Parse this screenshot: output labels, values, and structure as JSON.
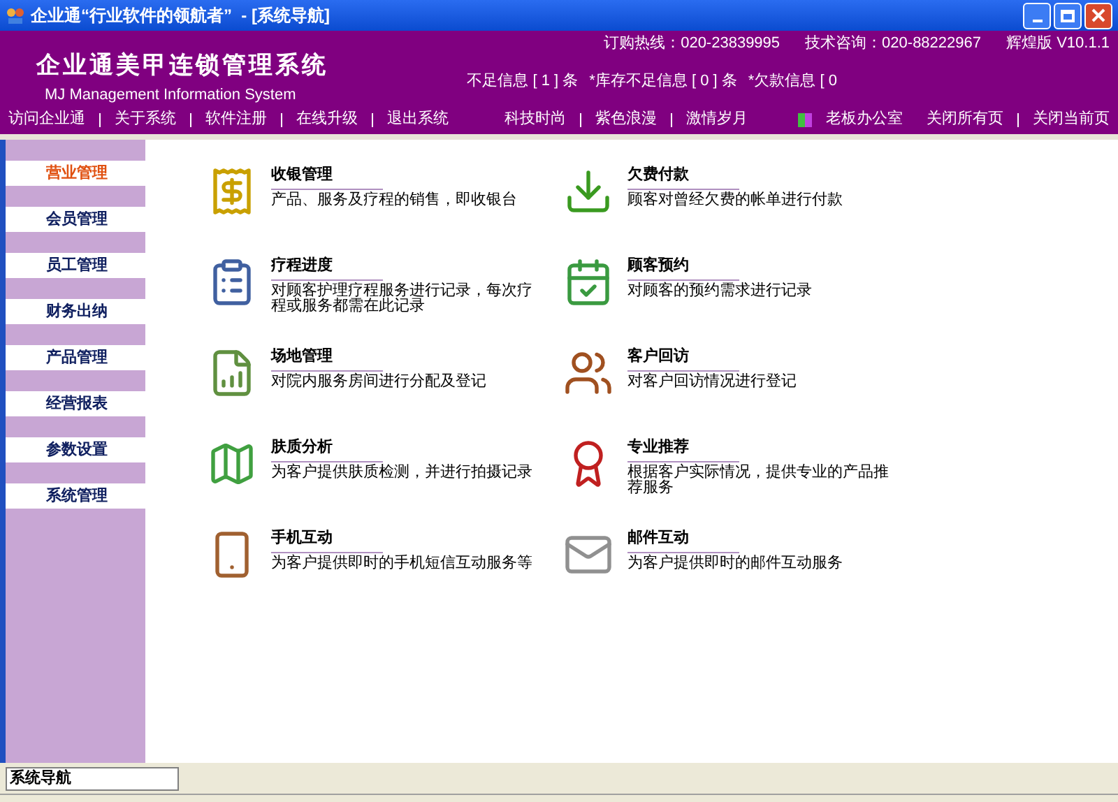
{
  "window": {
    "title": "企业通“行业软件的领航者”  - [系统导航]"
  },
  "header": {
    "app_title": "企业通美甲连锁管理系统",
    "app_subtitle": "MJ Management Information System",
    "contacts": [
      "订购热线：020-23839995",
      "技术咨询：020-88222967",
      "辉煌版 V10.1.1"
    ],
    "alerts": [
      "不足信息 [ 1 ] 条",
      "*库存不足信息 [ 0 ] 条",
      "*欠款信息 [ 0"
    ]
  },
  "nav": {
    "left": [
      "访问企业通",
      "关于系统",
      "软件注册",
      "在线升级",
      "退出系统"
    ],
    "themes": [
      "科技时尚",
      "紫色浪漫",
      "激情岁月"
    ],
    "office": "老板办公室",
    "right": [
      "关闭所有页",
      "关闭当前页"
    ]
  },
  "sidebar": {
    "items": [
      {
        "label": "营业管理",
        "selected": true
      },
      {
        "label": "会员管理",
        "selected": false
      },
      {
        "label": "员工管理",
        "selected": false
      },
      {
        "label": "财务出纳",
        "selected": false
      },
      {
        "label": "产品管理",
        "selected": false
      },
      {
        "label": "经营报表",
        "selected": false
      },
      {
        "label": "参数设置",
        "selected": false
      },
      {
        "label": "系统管理",
        "selected": false
      }
    ]
  },
  "modules": [
    {
      "kind": "cashier",
      "title": "收银管理",
      "desc": "产品、服务及疗程的销售，即收银台"
    },
    {
      "kind": "payment",
      "title": "欠费付款",
      "desc": "顾客对曾经欠费的帐单进行付款"
    },
    {
      "kind": "progress",
      "title": "疗程进度",
      "desc": "对顾客护理疗程服务进行记录，每次疗程或服务都需在此记录"
    },
    {
      "kind": "booking",
      "title": "顾客预约",
      "desc": "对顾客的预约需求进行记录"
    },
    {
      "kind": "room",
      "title": "场地管理",
      "desc": "对院内服务房间进行分配及登记"
    },
    {
      "kind": "visit",
      "title": "客户回访",
      "desc": "对客户回访情况进行登记"
    },
    {
      "kind": "skin",
      "title": "肤质分析",
      "desc": "为客户提供肤质检测，并进行拍摄记录"
    },
    {
      "kind": "recommend",
      "title": "专业推荐",
      "desc": "根据客户实际情况，提供专业的产品推荐服务"
    },
    {
      "kind": "mobile",
      "title": "手机互动",
      "desc": "为客户提供即时的手机短信互动服务等"
    },
    {
      "kind": "mail",
      "title": "邮件互动",
      "desc": "为客户提供即时的邮件互动服务"
    }
  ],
  "tabs": [
    {
      "label": "系统导航",
      "selected": true
    }
  ]
}
